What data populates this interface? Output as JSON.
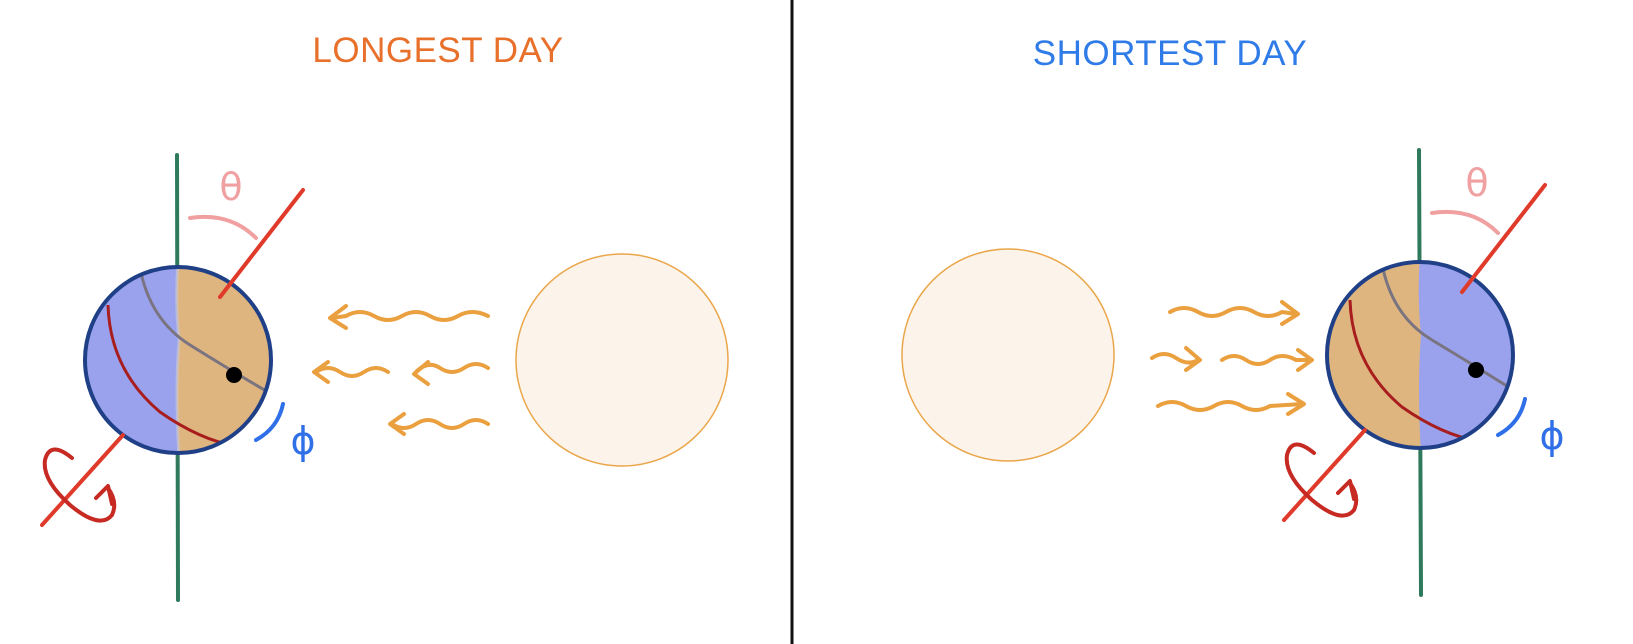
{
  "panels": {
    "left": {
      "title": "LONGEST DAY"
    },
    "right": {
      "title": "SHORTEST DAY"
    }
  },
  "symbols": {
    "theta": "θ",
    "phi": "ϕ"
  },
  "colors": {
    "longest_title": "#e8702a",
    "shortest_title": "#2f7be8",
    "night": "#9aa2ee",
    "day": "#dfb57f",
    "earth_outline": "#1f3f86",
    "vertical_axis": "#2f7a5c",
    "tilted_axis": "#e03a2a",
    "rotation_arrow": "#c62a22",
    "latitude_circle": "#a81e1e",
    "meridian": "#7a7480",
    "theta_arc": "#f0a0a0",
    "phi_color": "#2f6fe8",
    "sun_fill": "#fcf3ea",
    "sun_outline": "#eaa64a",
    "light_rays": "#eba040",
    "divider": "#111111"
  }
}
